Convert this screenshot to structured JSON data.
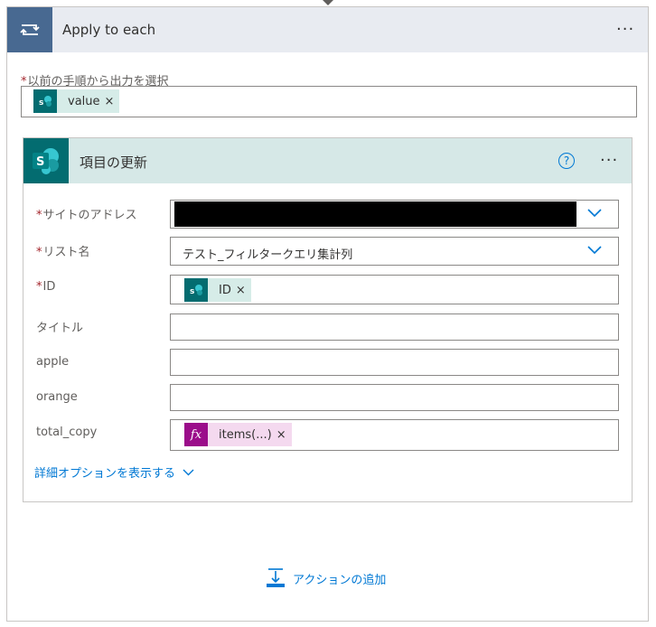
{
  "loop": {
    "title": "Apply to each",
    "more_label": "···",
    "select_output_label": "以前の手順から出力を選択",
    "select_output_token": "value",
    "token_remove": "×"
  },
  "action": {
    "title": "項目の更新",
    "help_label": "?",
    "more_label": "···",
    "fields": {
      "site_address_label": "サイトのアドレス",
      "list_name_label": "リスト名",
      "list_name_value": "テスト_フィルタークエリ集計列",
      "id_label": "ID",
      "id_token": "ID",
      "title_label": "タイトル",
      "apple_label": "apple",
      "orange_label": "orange",
      "total_copy_label": "total_copy",
      "total_copy_token": "items(...)",
      "fx_glyph": "fx"
    },
    "advanced_options": "詳細オプションを表示する"
  },
  "add_action_label": "アクションの追加",
  "required_marker": "*",
  "icons": {
    "loop": "loop-arrows-icon",
    "sharepoint": "sharepoint-icon",
    "expression": "fx-icon",
    "chevron": "chevron-down-icon",
    "add_action": "add-action-icon"
  },
  "colors": {
    "loop_icon_bg": "#486991",
    "sharepoint_teal": "#036c70",
    "expression_purple": "#9b0d8a",
    "link_blue": "#0078d4"
  }
}
